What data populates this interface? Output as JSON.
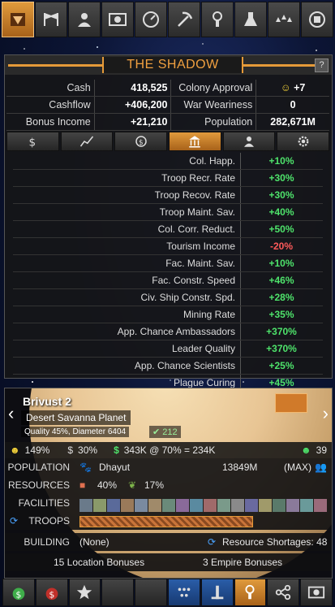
{
  "empire": {
    "title": "THE SHADOW",
    "help": "?",
    "stats": [
      {
        "label": "Cash",
        "value": "418,525",
        "label2": "Colony Approval",
        "value2": "+7"
      },
      {
        "label": "Cashflow",
        "value": "+406,200",
        "label2": "War Weariness",
        "value2": "0"
      },
      {
        "label": "Bonus Income",
        "value": "+21,210",
        "label2": "Population",
        "value2": "282,671M"
      }
    ]
  },
  "tabs": [
    "dollar-icon",
    "chart-icon",
    "refresh-dollar-icon",
    "government-icon",
    "person-icon",
    "gear-icon"
  ],
  "bonuses": [
    {
      "label": "Col. Happ.",
      "value": "+10%"
    },
    {
      "label": "Troop Recr. Rate",
      "value": "+30%"
    },
    {
      "label": "Troop Recov. Rate",
      "value": "+30%"
    },
    {
      "label": "Troop Maint. Sav.",
      "value": "+40%"
    },
    {
      "label": "Col. Corr. Reduct.",
      "value": "+50%"
    },
    {
      "label": "Tourism Income",
      "value": "-20%"
    },
    {
      "label": "Fac. Maint. Sav.",
      "value": "+10%"
    },
    {
      "label": "Fac. Constr. Speed",
      "value": "+46%"
    },
    {
      "label": "Civ. Ship Constr. Spd.",
      "value": "+28%"
    },
    {
      "label": "Mining Rate",
      "value": "+35%"
    },
    {
      "label": "App. Chance Ambassadors",
      "value": "+370%"
    },
    {
      "label": "Leader Quality",
      "value": "+370%"
    },
    {
      "label": "App. Chance Scientists",
      "value": "+25%"
    },
    {
      "label": "Plague Curing",
      "value": "+45%"
    }
  ],
  "planet": {
    "name": "Brivust 2",
    "type": "Desert Savanna Planet",
    "quality": "Quality 45%, Diameter 6404",
    "quality_extra": "212",
    "happiness": "149%",
    "tax": "30%",
    "income": "343K @ 70% = 234K",
    "approval": "39",
    "population_label": "POPULATION",
    "race": "Dhayut",
    "population": "13849M",
    "population_max": "(MAX)",
    "resources_label": "RESOURCES",
    "resource1": "40%",
    "resource2": "17%",
    "facilities_label": "FACILITIES",
    "troops_label": "TROOPS",
    "building_label": "BUILDING",
    "building": "(None)",
    "shortages": "Resource Shortages: 48",
    "location_bonuses": "15 Location Bonuses",
    "empire_bonuses": "3 Empire Bonuses"
  },
  "colors": {
    "accent": "#e59a39",
    "positive": "#4ee36b",
    "negative": "#ff5a5a"
  }
}
